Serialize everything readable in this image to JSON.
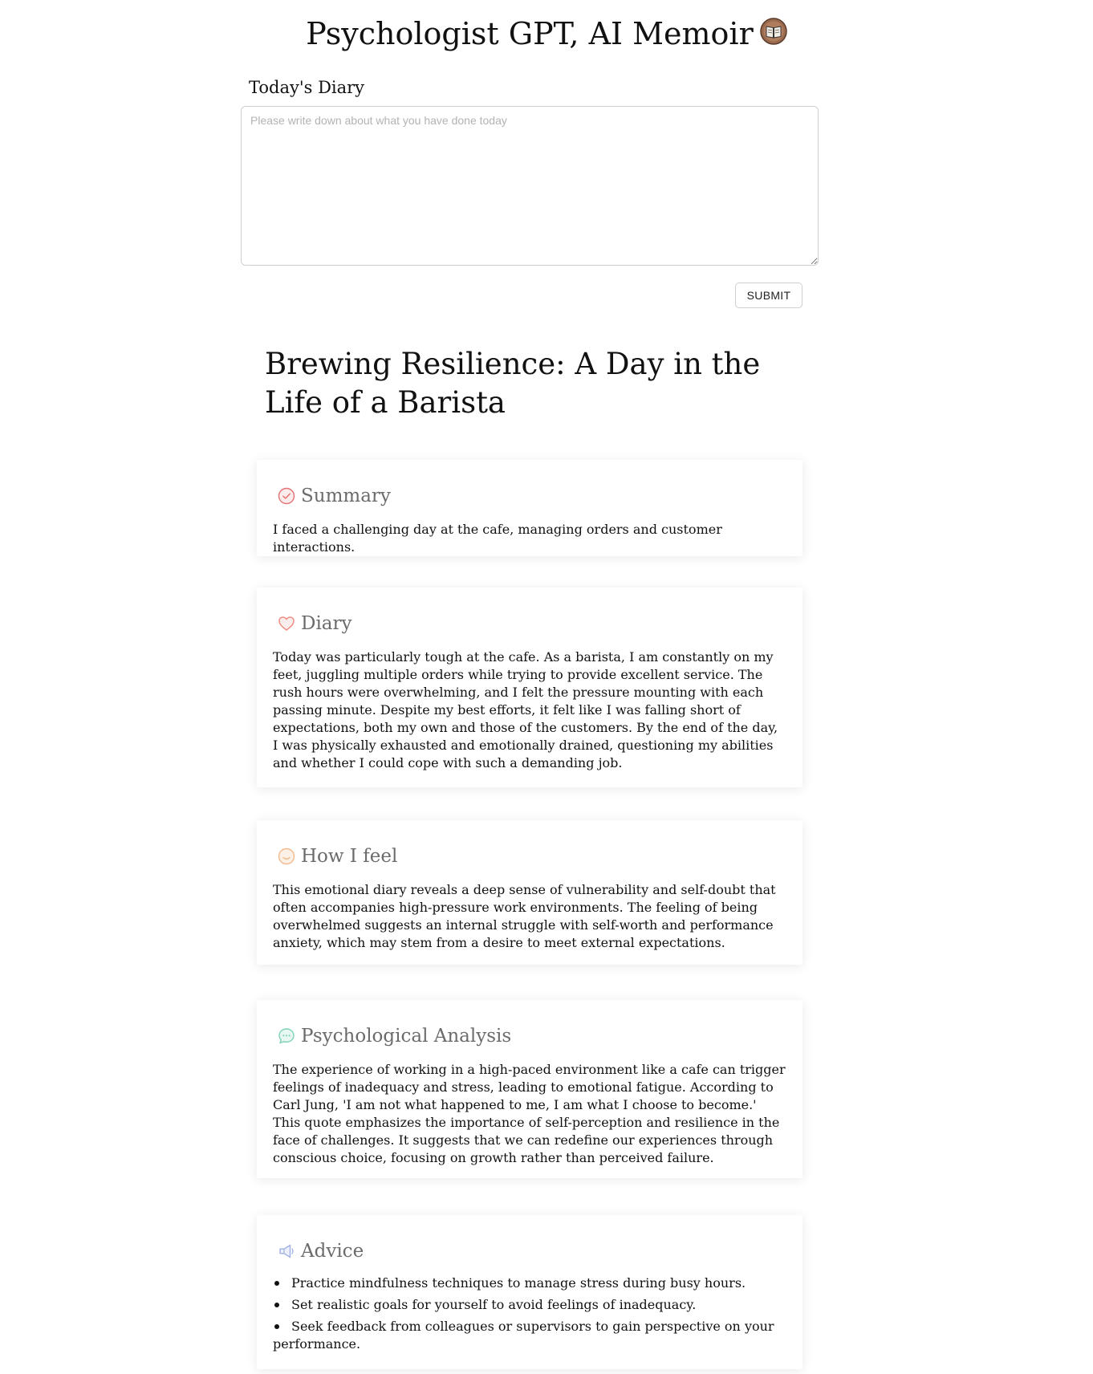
{
  "header": {
    "title": "Psychologist GPT, AI Memoir",
    "icon": "book-emoji-icon"
  },
  "diary_form": {
    "label": "Today's Diary",
    "input_value": "",
    "placeholder": "Please write down about what you have done today",
    "submit_label": "SUBMIT"
  },
  "result": {
    "title": "Brewing Resilience: A Day in the Life of a Barista",
    "sections": [
      {
        "title": "Summary",
        "icon": "check-circle-icon",
        "icon_color": "#e57373",
        "text": "I faced a challenging day at the cafe, managing orders and customer interactions."
      },
      {
        "title": "Diary",
        "icon": "heart-icon",
        "icon_color": "#ef8a80",
        "text": "Today was particularly tough at the cafe. As a barista, I am constantly on my feet, juggling multiple orders while trying to provide excellent service. The rush hours were overwhelming, and I felt the pressure mounting with each passing minute. Despite my best efforts, it felt like I was falling short of expectations, both my own and those of the customers. By the end of the day, I was physically exhausted and emotionally drained, questioning my abilities and whether I could cope with such a demanding job."
      },
      {
        "title": "How I feel",
        "icon": "smile-face-icon",
        "icon_color": "#f2b98c",
        "text": "This emotional diary reveals a deep sense of vulnerability and self-doubt that often accompanies high-pressure work environments. The feeling of being overwhelmed suggests an internal struggle with self-worth and performance anxiety, which may stem from a desire to meet external expectations."
      },
      {
        "title": "Psychological Analysis",
        "icon": "chat-bubble-icon",
        "icon_color": "#7fd1b9",
        "text": "The experience of working in a high-paced environment like a cafe can trigger feelings of inadequacy and stress, leading to emotional fatigue. According to Carl Jung, 'I am not what happened to me, I am what I choose to become.' This quote emphasizes the importance of self-perception and resilience in the face of challenges. It suggests that we can redefine our experiences through conscious choice, focusing on growth rather than perceived failure."
      },
      {
        "title": "Advice",
        "icon": "megaphone-icon",
        "icon_color": "#9fb0e6",
        "items": [
          "Practice mindfulness techniques to manage stress during busy hours.",
          "Set realistic goals for yourself to avoid feelings of inadequacy.",
          "Seek feedback from colleagues or supervisors to gain perspective on your performance."
        ]
      }
    ]
  }
}
